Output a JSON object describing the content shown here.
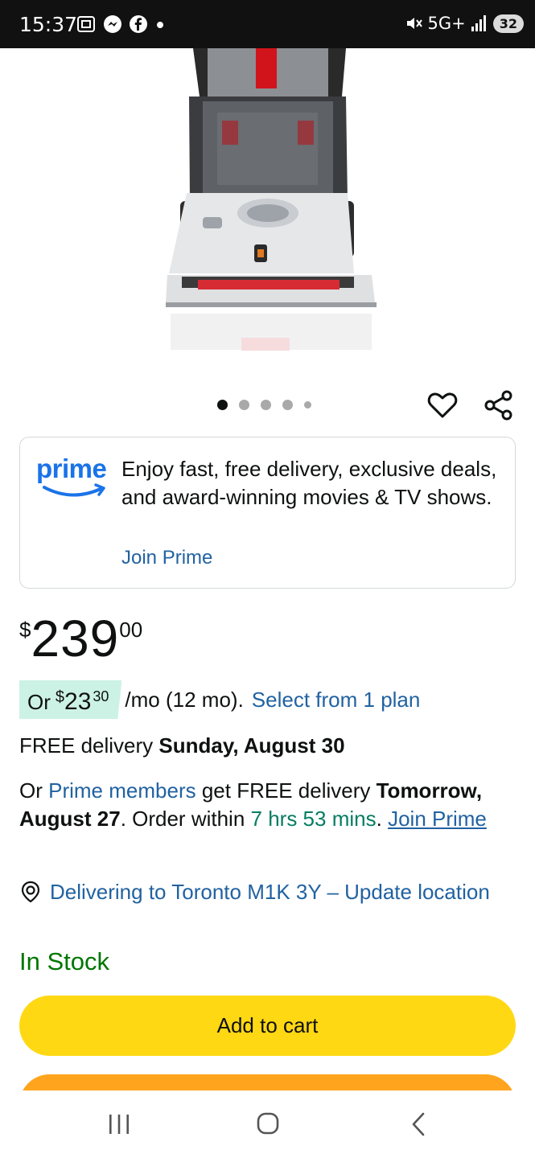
{
  "status_bar": {
    "time": "15:37",
    "network": "5G+",
    "battery": "32",
    "icons_left": [
      "screenshot-icon",
      "messenger-icon",
      "facebook-icon",
      "dot-icon"
    ],
    "icons_right": [
      "mute-icon",
      "signal-icon",
      "battery-icon"
    ]
  },
  "carousel": {
    "total_dots": 5,
    "active_index": 0
  },
  "prime_card": {
    "logo_text": "prime",
    "description": "Enjoy fast, free delivery, exclusive deals, and award-winning movies & TV shows.",
    "join_link": "Join Prime"
  },
  "price": {
    "symbol": "$",
    "whole": "239",
    "fraction": "00"
  },
  "installment": {
    "prefix": "Or",
    "symbol": "$",
    "amount": "23",
    "cents": "30",
    "term": "/mo (12 mo).",
    "link": "Select from 1 plan"
  },
  "delivery": {
    "prefix": "FREE delivery",
    "date": "Sunday, August 30"
  },
  "prime_delivery": {
    "or": "Or",
    "members_link": "Prime members",
    "middle": "get FREE delivery",
    "date": "Tomorrow, August 27",
    "order_within": ". Order within",
    "countdown": "7 hrs 53 mins",
    "period": ".",
    "join_link": "Join Prime"
  },
  "location": {
    "text": "Delivering to Toronto M1K 3Y – Update location"
  },
  "stock": "In Stock",
  "add_to_cart": "Add to cart",
  "colors": {
    "add_to_cart": "#ffd814",
    "buy_now": "#ffa41c",
    "link": "#2162a1",
    "in_stock": "#007600",
    "countdown": "#067d62",
    "installment_chip": "#ccf2e6"
  }
}
